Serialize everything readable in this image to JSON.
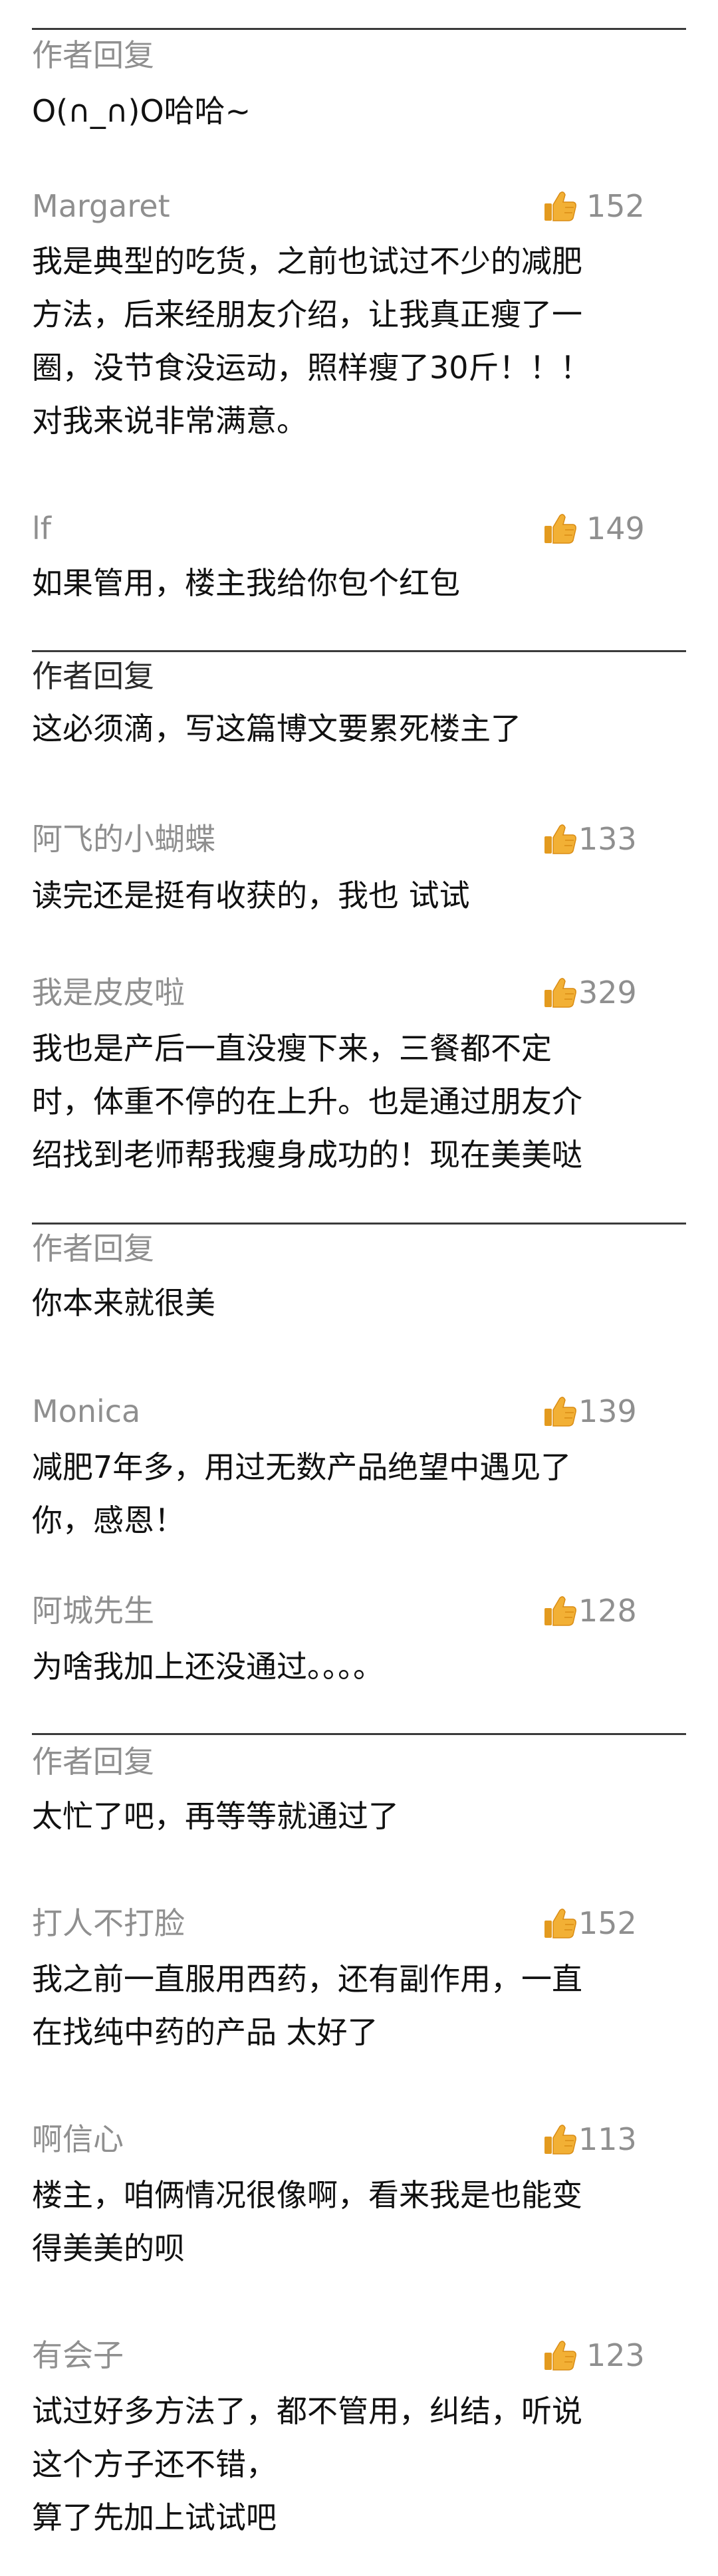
{
  "colors": {
    "meta_text": "#8f8f8f",
    "body_text": "#111111",
    "divider": "#3a3a3a",
    "thumb": "#f2b035"
  },
  "comments": [
    {
      "author": "作者回复",
      "text": [
        "O(∩_∩)O哈哈~"
      ]
    },
    {
      "author": "Margaret",
      "likes": "152",
      "text": [
        "我是典型的吃货，之前也试过不少的减肥",
        "方法，后来经朋友介绍，让我真正瘦了一",
        "圈，没节食没运动，照样瘦了30斤！！！",
        "对我来说非常满意。"
      ]
    },
    {
      "author": "lf",
      "likes": "149",
      "text": [
        "如果管用，楼主我给你包个红包"
      ]
    },
    {
      "author": "作者回复",
      "text": [
        "这必须滴，写这篇博文要累死楼主了"
      ]
    },
    {
      "author": "阿飞的小蝴蝶",
      "likes": "133",
      "text": [
        "读完还是挺有收获的，我也 试试"
      ]
    },
    {
      "author": "我是皮皮啦",
      "likes": "329",
      "text": [
        "我也是产后一直没瘦下来，三餐都不定",
        "时，体重不停的在上升。也是通过朋友介",
        "绍找到老师帮我瘦身成功的！现在美美哒"
      ]
    },
    {
      "author": "作者回复",
      "text": [
        "你本来就很美"
      ]
    },
    {
      "author": "Monica",
      "likes": "139",
      "text": [
        "减肥7年多，用过无数产品绝望中遇见了",
        "你，感恩！"
      ]
    },
    {
      "author": "阿城先生",
      "likes": "128",
      "text": [
        "为啥我加上还没通过。。。。"
      ]
    },
    {
      "author": "作者回复",
      "text": [
        "太忙了吧，再等等就通过了"
      ]
    },
    {
      "author": "打人不打脸",
      "likes": "152",
      "text": [
        "我之前一直服用西药，还有副作用，一直",
        "在找纯中药的产品 太好了"
      ]
    },
    {
      "author": "啊信心",
      "likes": "113",
      "text": [
        "楼主，咱俩情况很像啊，看来我是也能变",
        "得美美的呗"
      ]
    },
    {
      "author": "有会子",
      "likes": "123",
      "text": [
        "试过好多方法了，都不管用，纠结，听说",
        "这个方子还不错，",
        "算了先加上试试吧"
      ]
    }
  ]
}
